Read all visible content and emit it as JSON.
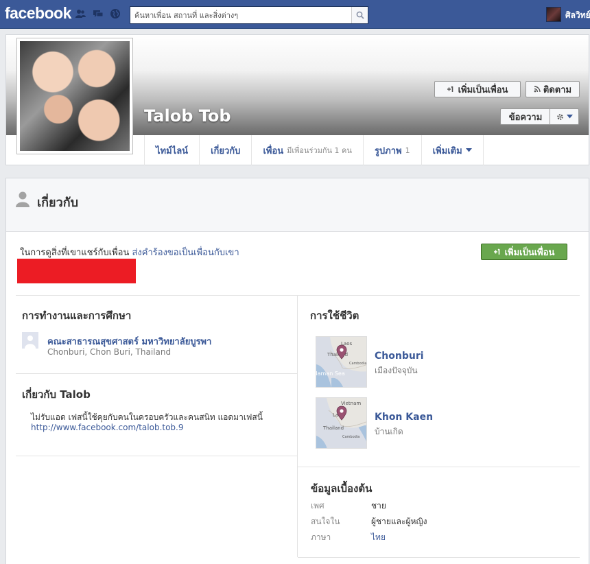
{
  "topbar": {
    "logo": "facebook",
    "search_placeholder": "ค้นหาเพื่อน สถานที่ และสิ่งต่างๆ",
    "user_name": "ศิลวิทย์"
  },
  "profile": {
    "name": "Talob Tob",
    "add_friend_label": "เพิ่มเป็นเพื่อน",
    "follow_label": "ติดตาม",
    "message_label": "ข้อความ"
  },
  "tabs": [
    {
      "label": "ไทม์ไลน์",
      "sub": ""
    },
    {
      "label": "เกี่ยวกับ",
      "sub": ""
    },
    {
      "label": "เพื่อน",
      "sub": "มีเพื่อนร่วมกัน 1 คน"
    },
    {
      "label": "รูปภาพ",
      "sub": "1"
    },
    {
      "label": "เพิ่มเติม",
      "sub": ""
    }
  ],
  "about": {
    "title": "เกี่ยวกับ",
    "notice_text": "ในการดูสิ่งที่เขาแชร์กับเพื่อน",
    "notice_link": "ส่งคำร้องขอเป็นเพื่อนกับเขา",
    "add_friend_label": "เพิ่มเป็นเพื่อน"
  },
  "work": {
    "title": "การทำงานและการศึกษา",
    "name": "คณะสาธารณสุขศาสตร์ มหาวิทยาลัยบูรพา",
    "location": "Chonburi, Chon Buri, Thailand"
  },
  "bio": {
    "title": "เกี่ยวกับ Talob",
    "text": "ไม่รับแอด เฟสนี้ใช้คุยกับคนในครอบครัวและคนสนิท แอดมาเฟสนี้",
    "link": "http://www.facebook.com/talob.tob.9"
  },
  "places": {
    "title": "การใช้ชีวิต",
    "items": [
      {
        "name": "Chonburi",
        "sub": "เมืองปัจจุบัน",
        "map_labels": [
          "Laos",
          "Thailand",
          "Cambodia",
          "Andaman Sea"
        ]
      },
      {
        "name": "Khon Kaen",
        "sub": "บ้านเกิด",
        "map_labels": [
          "Vietnam",
          "Laos",
          "Thailand",
          "Cambodia"
        ]
      }
    ]
  },
  "basic": {
    "title": "ข้อมูลเบื้องต้น",
    "rows": [
      {
        "label": "เพศ",
        "value": "ชาย"
      },
      {
        "label": "สนใจใน",
        "value": "ผู้ชายและผู้หญิง"
      },
      {
        "label": "ภาษา",
        "value": "ไทย"
      }
    ]
  },
  "colors": {
    "brand": "#3b5998",
    "green_button": "#69a74e",
    "redaction": "#ec1c24"
  }
}
